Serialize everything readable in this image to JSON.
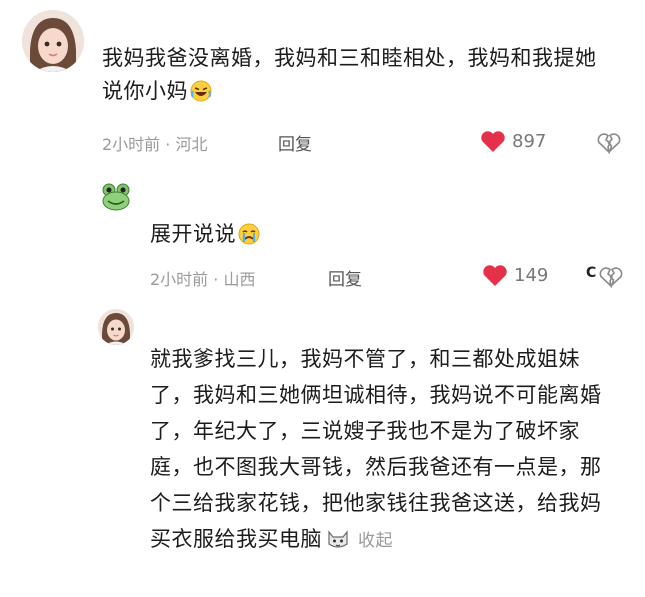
{
  "comments": [
    {
      "text": "我妈我爸没离婚，我妈和三和睦相处，我妈和我提她说你小妈",
      "time": "2小时前",
      "location": "河北",
      "reply_label": "回复",
      "likes": "897"
    },
    {
      "text": "展开说说",
      "time": "2小时前",
      "location": "山西",
      "reply_label": "回复",
      "likes": "149"
    },
    {
      "text": "就我爹找三儿，我妈不管了，和三都处成姐妹了，我妈和三她俩坦诚相待，我妈说不可能离婚了，年纪大了，三说嫂子我也不是为了破坏家庭，也不图我大哥钱，然后我爸还有一点是，那个三给我家花钱，把他家钱往我爸这送，给我妈买衣服给我买电脑",
      "collapse_label": "收起"
    }
  ],
  "separator": "·",
  "colors": {
    "like_heart": "#e5304a",
    "meta_text": "#9a9a9a"
  }
}
